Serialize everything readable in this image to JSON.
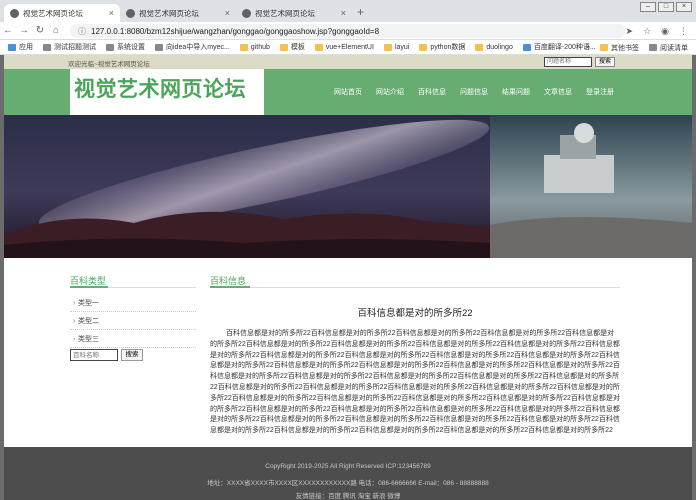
{
  "browser": {
    "tabs": [
      {
        "label": "视觉艺术网页论坛",
        "active": true
      },
      {
        "label": "视觉艺术网页论坛",
        "active": false
      },
      {
        "label": "视觉艺术网页论坛",
        "active": false
      }
    ],
    "url": "127.0.0.1:8080/bzm12shijue/wangzhan/gonggao/gonggaoshow.jsp?gonggaoId=8",
    "bookmarks": [
      "应用",
      "测试招题测试",
      "系统设置",
      "向idea中导入myec...",
      "github",
      "模板",
      "vue+ElementUI",
      "layui",
      "python数据",
      "duolingo",
      "百度翻译-200种语..."
    ],
    "bookmarks_right": [
      "其他书签",
      "阅读清单"
    ]
  },
  "topbar": {
    "welcome": "欢迎光临~视觉艺术网页论坛",
    "search_placeholder": "问题名称",
    "search_button": "搜索"
  },
  "header": {
    "logo": "视觉艺术网页论坛",
    "menu": [
      "网站首页",
      "网站介绍",
      "百科信息",
      "问题信息",
      "结果问题",
      "文章信息",
      "登录注册"
    ]
  },
  "carousel": {
    "slides": 3,
    "active": 3
  },
  "sidebar": {
    "title": "百科类型",
    "items": [
      "类型一",
      "类型二",
      "类型三"
    ],
    "search_placeholder": "百科名称",
    "search_button": "搜索"
  },
  "main": {
    "section_title": "百科信息",
    "article_title": "百科信息都是对的所多所22",
    "article_body": "百科信息都是对的所多所22百科信息都是对的所多所22百科信息都是对的所多所22百科信息都是对的所多所22百科信息都是对的所多所22百科信息都是对的所多所22百科信息都是对的所多所22百科信息都是对的所多所22百科信息都是对的所多所22百科信息都是对的所多所22百科信息都是对的所多所22百科信息都是对的所多所22百科信息都是对的所多所22百科信息都是对的所多所22百科信息都是对的所多所22百科信息都是对的所多所22百科信息都是对的所多所22百科信息都是对的所多所22百科信息都是对的所多所22百科信息都是对的所多所22百科信息都是对的所多所22百科信息都是对的所多所22百科信息都是对的所多所22百科信息都是对的所多所22百科信息都是对的所多所22百科信息都是对的所多所22百科信息都是对的所多所22百科信息都是对的所多所22百科信息都是对的所多所22百科信息都是对的所多所22百科信息都是对的所多所22百科信息都是对的所多所22百科信息都是对的所多所22百科信息都是对的所多所22百科信息都是对的所多所22百科信息都是对的所多所22百科信息都是对的所多所22百科信息都是对的所多所22百科信息都是对的所多所22百科信息都是对的所多所22百科信息都是对的所多所22百科信息都是对的所多所22百科信息都是对的所多所22百科信息都是对的所多所22百科信息都是对的所多所22百科信息都是对的所多所22百科信息都是对的所多所22百科信息都是对的所多所22"
  },
  "footer": {
    "copyright": "CopyRight 2019-2025 All Right Reserved  ICP:123456789",
    "address": "地址：XXXX省XXXX市XXXX区XXXXXXXXXXXX路  电话：086-6666666  E-mail：086 - 88888888",
    "links": "友情链接：百度 腾讯 淘宝 新浪 微博"
  },
  "colors": {
    "accent": "#67ac71",
    "logo": "#4aa55a",
    "topbar": "#dcdbc6",
    "footer": "#4d4d4d"
  }
}
